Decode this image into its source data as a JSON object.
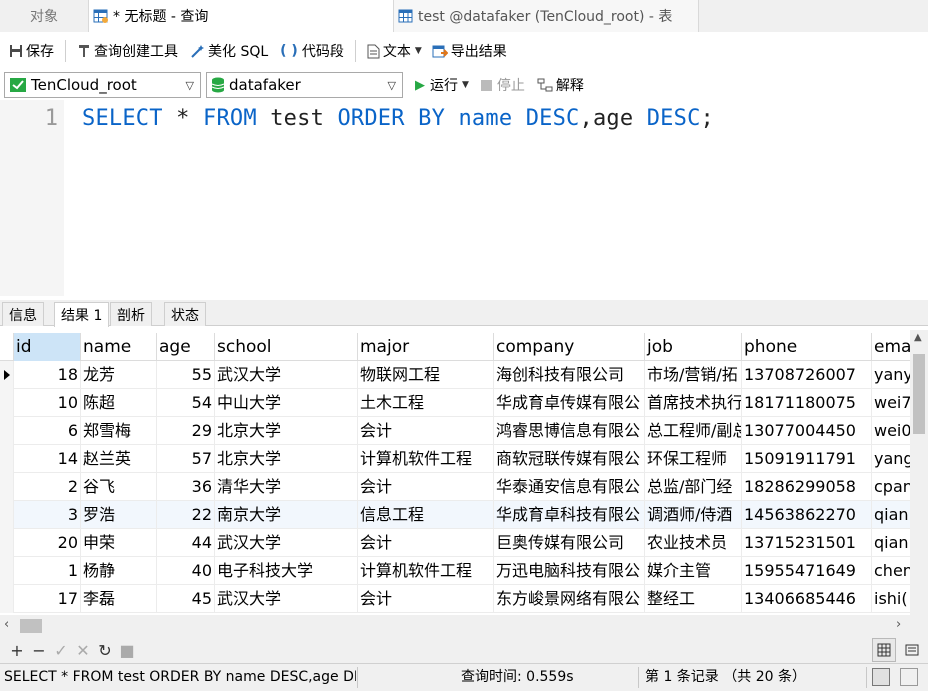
{
  "tabs": {
    "objects": "对象",
    "query": "* 无标题 - 查询",
    "table": "test @datafaker (TenCloud_root) - 表"
  },
  "toolbar": {
    "save": "保存",
    "query_builder": "查询创建工具",
    "beautify": "美化 SQL",
    "snippet": "代码段",
    "text": "文本",
    "export": "导出结果"
  },
  "selectors": {
    "connection": "TenCloud_root",
    "database": "datafaker",
    "run": "运行",
    "stop": "停止",
    "explain": "解释"
  },
  "editor": {
    "line_number": "1",
    "sql_tokens": [
      {
        "t": "SELECT",
        "k": true
      },
      {
        "t": " * ",
        "k": false
      },
      {
        "t": "FROM",
        "k": true
      },
      {
        "t": " test ",
        "k": false
      },
      {
        "t": "ORDER BY",
        "k": true
      },
      {
        "t": " ",
        "k": false
      },
      {
        "t": "name",
        "k": true
      },
      {
        "t": " ",
        "k": false
      },
      {
        "t": "DESC",
        "k": true
      },
      {
        "t": ",age ",
        "k": false
      },
      {
        "t": "DESC",
        "k": true
      },
      {
        "t": ";",
        "k": false
      }
    ]
  },
  "result_tabs": [
    "信息",
    "结果 1",
    "剖析",
    "状态"
  ],
  "grid": {
    "columns": [
      "id",
      "name",
      "age",
      "school",
      "major",
      "company",
      "job",
      "phone",
      "ema"
    ],
    "rows": [
      [
        "18",
        "龙芳",
        "55",
        "武汉大学",
        "物联网工程",
        "海创科技有限公司",
        "市场/营销/拓",
        "13708726007",
        "yany"
      ],
      [
        "10",
        "陈超",
        "54",
        "中山大学",
        "土木工程",
        "华成育卓传媒有限公",
        "首席技术执行",
        "18171180075",
        "wei7"
      ],
      [
        "6",
        "郑雪梅",
        "29",
        "北京大学",
        "会计",
        "鸿睿思博信息有限公",
        "总工程师/副总",
        "13077004450",
        "wei0"
      ],
      [
        "14",
        "赵兰英",
        "57",
        "北京大学",
        "计算机软件工程",
        "商软冠联传媒有限公",
        "环保工程师",
        "15091911791",
        "yang"
      ],
      [
        "2",
        "谷飞",
        "36",
        "清华大学",
        "会计",
        "华泰通安信息有限公",
        "总监/部门经",
        "18286299058",
        "cpan"
      ],
      [
        "3",
        "罗浩",
        "22",
        "南京大学",
        "信息工程",
        "华成育卓科技有限公",
        "调酒师/侍酒",
        "14563862270",
        "qian"
      ],
      [
        "20",
        "申荣",
        "44",
        "武汉大学",
        "会计",
        "巨奥传媒有限公司",
        "农业技术员",
        "13715231501",
        "qian"
      ],
      [
        "1",
        "杨静",
        "40",
        "电子科技大学",
        "计算机软件工程",
        "万迅电脑科技有限公",
        "媒介主管",
        "15955471649",
        "chen"
      ],
      [
        "17",
        "李磊",
        "45",
        "武汉大学",
        "会计",
        "东方峻景网络有限公",
        "整经工",
        "13406685446",
        "ishi("
      ]
    ]
  },
  "actions": [
    "+",
    "−",
    "✓",
    "✕",
    "↻",
    "■"
  ],
  "status": {
    "sql": "SELECT * FROM test ORDER BY name DESC,age DESC;",
    "time": "查询时间: 0.559s",
    "record": "第 1 条记录 （共 20 条）"
  }
}
